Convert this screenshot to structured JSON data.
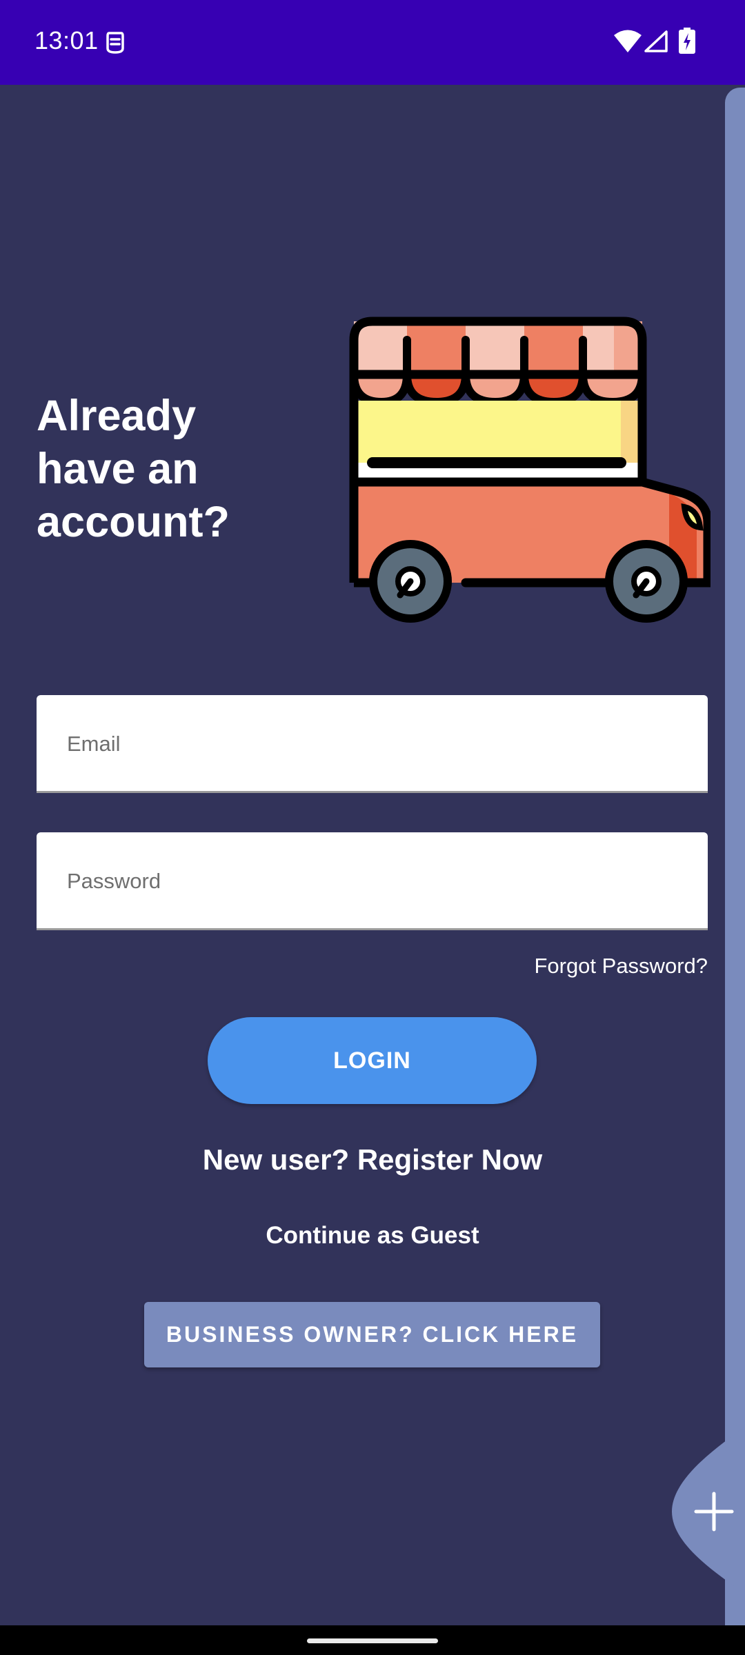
{
  "status_bar": {
    "time": "13:01",
    "icons": [
      "notification-icon",
      "wifi-icon",
      "signal-icon",
      "battery-charging-icon"
    ]
  },
  "login": {
    "title": "Already have an account?",
    "email": {
      "placeholder": "Email",
      "value": ""
    },
    "password": {
      "placeholder": "Password",
      "value": ""
    },
    "forgot_password": "Forgot Password?",
    "login_button": "LOGIN",
    "register_link": "New user? Register Now",
    "guest_link": "Continue as Guest",
    "business_button": "BUSINESS OWNER? CLICK HERE"
  },
  "illustration": {
    "icon": "food-truck-icon"
  },
  "fab": {
    "icon": "plus-icon"
  },
  "colors": {
    "status_bar": "#3700b3",
    "background": "#32335a",
    "accent_button": "#4a93ec",
    "secondary_button": "#7a8bbd",
    "side_panel": "#7a8bbd"
  }
}
